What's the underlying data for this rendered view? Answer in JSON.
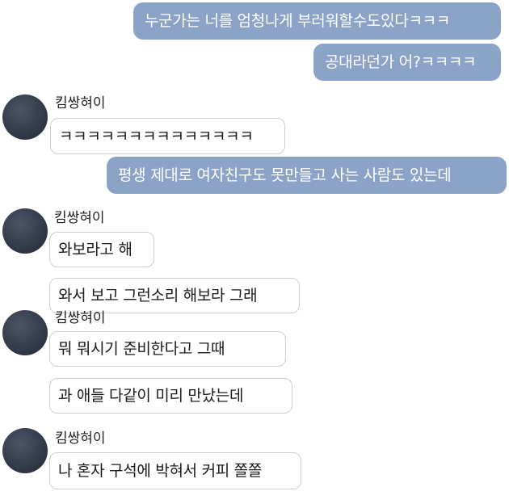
{
  "contact": {
    "name": "킴쌍혀이"
  },
  "messages": {
    "out1": "누군가는 너를 엄청나게 부러워할수도있다ㅋㅋㅋ",
    "out2": "공대라던가 어?ㅋㅋㅋㅋ",
    "in1": "ㅋㅋㅋㅋㅋㅋㅋㅋㅋㅋㅋㅋㅋㅋ",
    "out3": "평생 제대로 여자친구도 못만들고 사는 사람도 있는데",
    "in2": "와보라고 해",
    "in3": "와서 보고 그런소리 해보라 그래",
    "in4": "뭐 뭐시기 준비한다고 그때",
    "in5": "과 애들 다같이 미리 만났는데",
    "in6": "나 혼자 구석에 박혀서 커피 쫄쫄"
  },
  "colors": {
    "outgoing_bubble": "#8ca3c8",
    "incoming_border": "#cfcfcf",
    "avatar": "#2e3645"
  }
}
